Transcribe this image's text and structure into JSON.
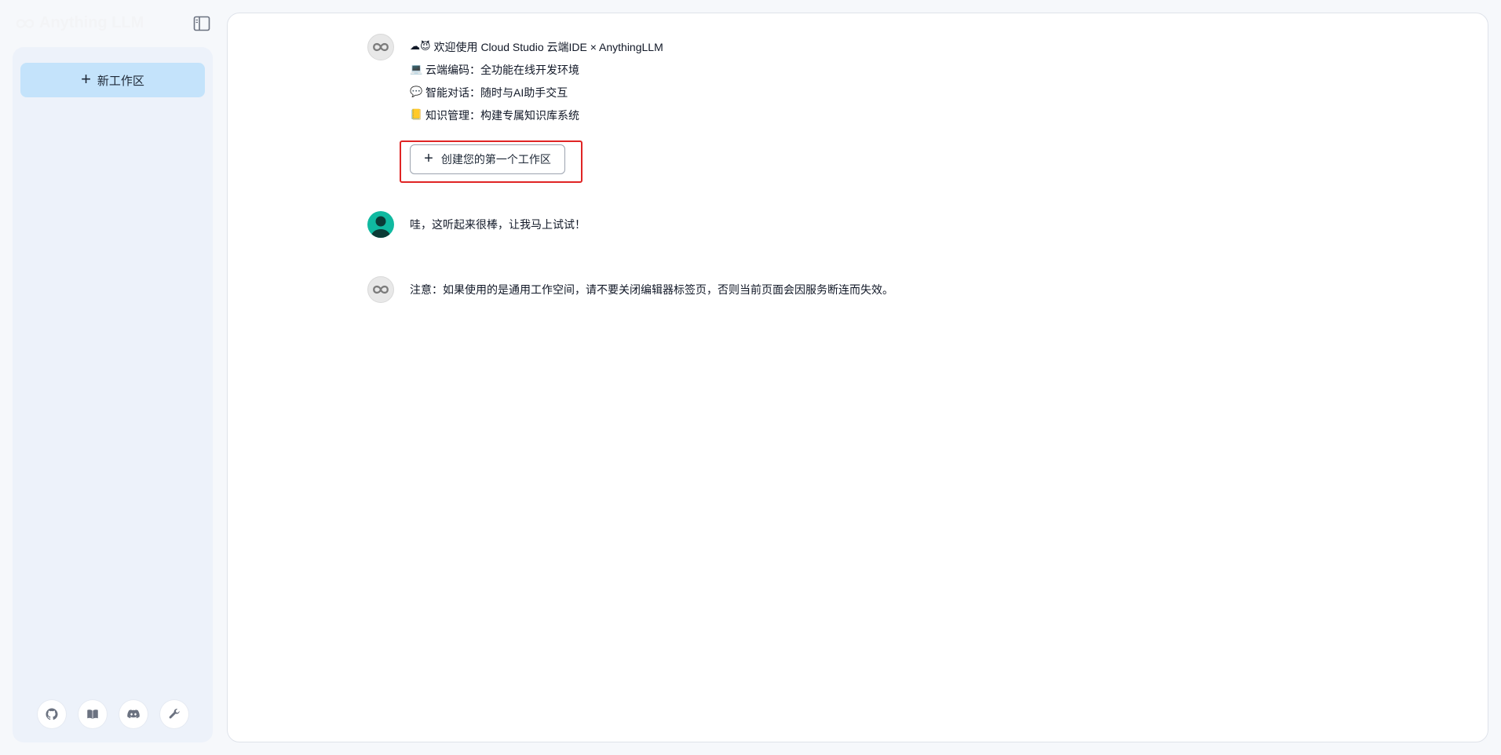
{
  "app": {
    "brand_name": "Anything LLM"
  },
  "sidebar": {
    "new_workspace_label": "新工作区",
    "footer_icons": [
      "github-icon",
      "book-icon",
      "discord-icon",
      "wrench-icon"
    ]
  },
  "chat": {
    "welcome": {
      "title": "欢迎使用 Cloud Studio 云端IDE × AnythingLLM",
      "title_emojis": "☁😈",
      "features": [
        {
          "emoji": "💻",
          "icon": "laptop-icon",
          "text": "云端编码：全功能在线开发环境"
        },
        {
          "emoji": "💬",
          "icon": "chat-bubble-icon",
          "text": "智能对话：随时与AI助手交互"
        },
        {
          "emoji": "📒",
          "icon": "ledger-icon",
          "text": "知识管理：构建专属知识库系统"
        }
      ],
      "cta_label": "创建您的第一个工作区"
    },
    "user_reply": "哇，这听起来很棒，让我马上试试！",
    "note": "注意：如果使用的是通用工作空间，请不要关闭编辑器标签页，否则当前页面会因服务断连而失效。"
  },
  "colors": {
    "sidebar_bg": "#edf2fa",
    "new_workspace_bg": "#c4e3fb",
    "user_avatar": "#10b9a0",
    "highlight_frame": "#e02424"
  }
}
